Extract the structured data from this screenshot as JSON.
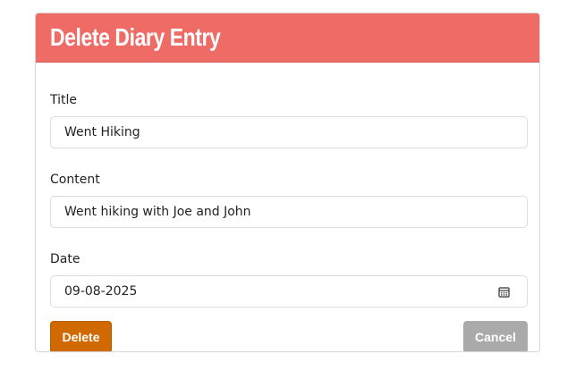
{
  "header": {
    "title": "Delete Diary Entry",
    "color": "#ee6b66"
  },
  "form": {
    "title": {
      "label": "Title",
      "value": "Went Hiking"
    },
    "content": {
      "label": "Content",
      "value": "Went hiking with Joe and John"
    },
    "date": {
      "label": "Date",
      "value": "09-08-2025",
      "icon": "calendar-icon"
    }
  },
  "buttons": {
    "delete_label": "Delete",
    "delete_color": "#d06a00",
    "cancel_label": "Cancel",
    "cancel_color": "#aaaaaa"
  }
}
